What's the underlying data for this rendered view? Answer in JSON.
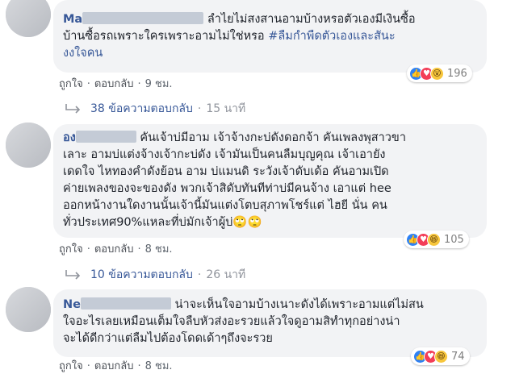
{
  "comments": [
    {
      "name_visible": "Ma",
      "text_line1": "ลำไยไม่สงสานอามบ้างหรอตัวเองมีเงินซื้อ",
      "text_line2_plain": "บ้านซื้อรถเพราะใครเพราะอามไม่ใช่หรอ ",
      "hashtag_part1": "#ลืมกำพืดตัวเองและสันะ",
      "hashtag_part2": "งงใจคน",
      "reaction_count": "196",
      "like_label": "ถูกใจ",
      "reply_label": "ตอบกลับ",
      "time": "9 ชม.",
      "replies_label": "38 ข้อความตอบกลับ",
      "replies_time": "15 นาที"
    },
    {
      "name_visible": "อง",
      "text_lines": [
        "คันเจ้าบ่มีอาม เจ้าจ้างกะบ่ดังดอกจ้า คันเพลงพุสาวขา",
        "เลาะ อามบ่แต่งจ้างเจ้ากะบ่ดัง เจ้ามันเป็นคนลืมบุญคุณ เจ้าเอายัง",
        "เดดใจ ไหทองคำดังย้อน อาม บ่แมนดิ ระวังเจ้าดับเด้อ คันอามเปิด",
        "ค่ายเพลงของจะของดัง พวกเจ้าสิดับทันทีท่าบ่มีคนจ้าง เอาแต่ hee",
        "ออกหน้างานใดงานนั้นเจ้านี้มันแต่งโตบสุภาพโชร์แต่ ไฮยี นั่น คน",
        "ทั่วประเทศ90%แหละที่บ่มักเจ้าผู้บ่🙄🙄"
      ],
      "reaction_count": "105",
      "like_label": "ถูกใจ",
      "reply_label": "ตอบกลับ",
      "time": "8 ชม.",
      "replies_label": "10 ข้อความตอบกลับ",
      "replies_time": "26 นาที"
    },
    {
      "name_visible": "Ne",
      "text_line1": "น่าจะเห็นใจอามบ้างเนาะดังได้เพราะอามแต่ไม่สน",
      "text_lines_rest": [
        "ใจอะไรเลยเหมือนเต็มใจลืบหัวส่งอะรวยแล้วใจดูอามสิทำทุกอย่างน่า",
        "จะได้ดีกว่าแต่ลืมไปต้องโดดเด้าๆถึงจะรวย"
      ],
      "reaction_count": "74",
      "like_label": "ถูกใจ",
      "reply_label": "ตอบกลับ",
      "time": "8 ชม."
    }
  ],
  "icons": {
    "like": "like-icon",
    "love": "love-icon",
    "wow": "wow-icon",
    "haha": "haha-icon",
    "reply_arrow": "reply-arrow-icon"
  },
  "colors": {
    "name": "#385898",
    "bubble": "#f2f3f5",
    "like": "#2e81f4",
    "love": "#f33e58",
    "emoji": "#f7c63c"
  }
}
